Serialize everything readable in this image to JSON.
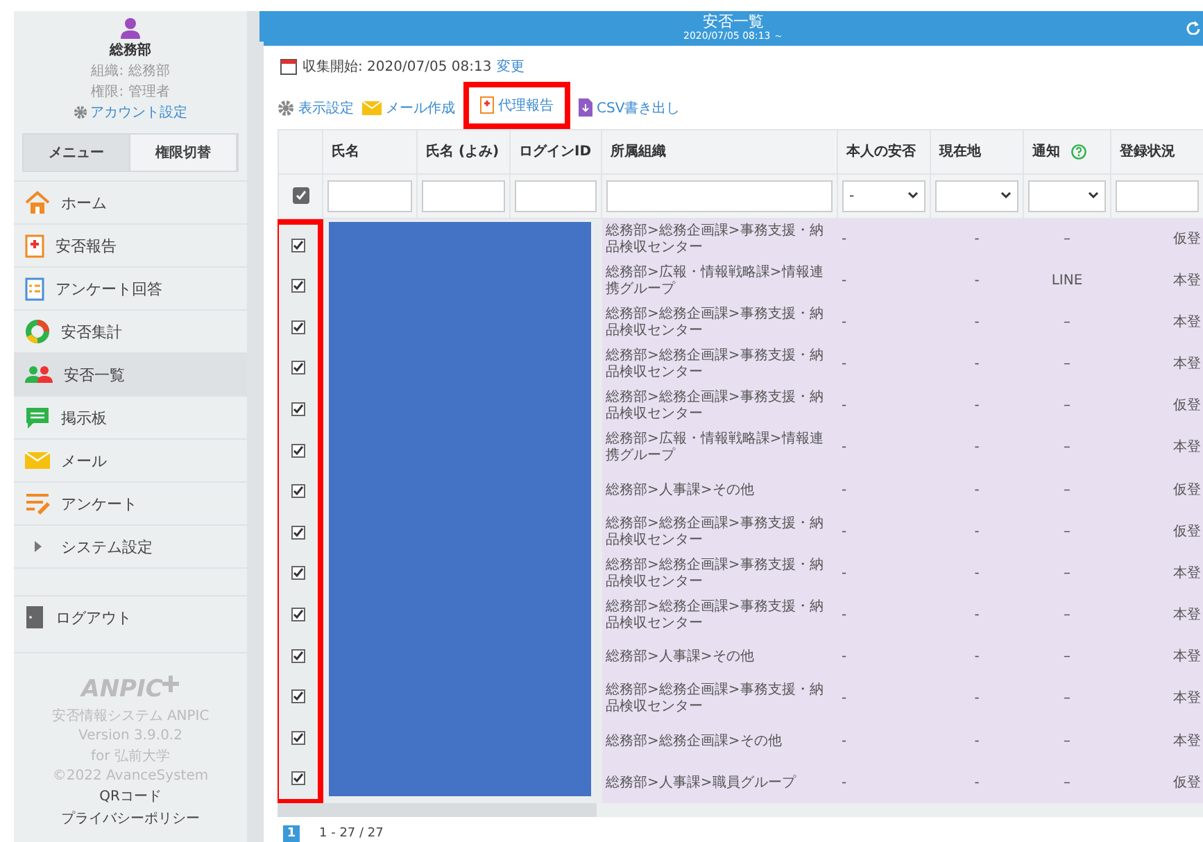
{
  "sidebar": {
    "user": {
      "name": "総務部",
      "org": "組織: 総務部",
      "role": "権限: 管理者",
      "account_link": "アカウント設定"
    },
    "tabs": [
      {
        "label": "メニュー",
        "selected": true
      },
      {
        "label": "権限切替",
        "selected": false
      }
    ],
    "items": [
      {
        "label": "ホーム",
        "kind": "link",
        "selected": false
      },
      {
        "label": "安否報告",
        "kind": "link",
        "selected": false
      },
      {
        "label": "アンケート回答",
        "kind": "link",
        "selected": false
      },
      {
        "label": "安否集計",
        "kind": "link",
        "selected": false
      },
      {
        "label": "安否一覧",
        "kind": "link",
        "selected": true
      },
      {
        "label": "掲示板",
        "kind": "link",
        "selected": false
      },
      {
        "label": "メール",
        "kind": "link",
        "selected": false
      },
      {
        "label": "アンケート",
        "kind": "link",
        "selected": false
      },
      {
        "label": "システム設定",
        "kind": "group",
        "selected": false
      }
    ],
    "logout": "ログアウト",
    "footer": {
      "logo": "ANPIC",
      "product": "安否情報システム ANPIC",
      "version": "Version 3.9.0.2",
      "for": "for 弘前大学",
      "copyright": "©2022 AvanceSystem",
      "links": [
        "QRコード",
        "プライバシーポリシー"
      ]
    }
  },
  "header": {
    "title": "安否一覧",
    "subtitle": "2020/07/05 08:13 ～"
  },
  "collection": {
    "label": "収集開始: 2020/07/05 08:13",
    "link": "変更"
  },
  "toolbar": [
    {
      "label": "表示設定",
      "highlighted": false
    },
    {
      "label": "メール作成",
      "highlighted": false
    },
    {
      "label": "代理報告",
      "highlighted": true
    },
    {
      "label": "CSV書き出し",
      "highlighted": false
    }
  ],
  "table": {
    "columns": [
      "氏名",
      "氏名 (よみ)",
      "ログインID",
      "所属組織",
      "本人の安否",
      "現在地",
      "通知",
      "登録状況"
    ],
    "header_checked": true,
    "filters": [
      {
        "kind": "input"
      },
      {
        "kind": "input"
      },
      {
        "kind": "input"
      },
      {
        "kind": "input"
      },
      {
        "kind": "select",
        "value": "-"
      },
      {
        "kind": "select"
      },
      {
        "kind": "select"
      },
      {
        "kind": "input"
      }
    ],
    "names_redacted": true,
    "checkbox_column_highlighted": true,
    "rows": [
      {
        "checked": true,
        "org": "総務部>総務企画課>事務支援・納品検収センター",
        "safety": "-",
        "location": "-",
        "notify": "–",
        "status": "仮登"
      },
      {
        "checked": true,
        "org": "総務部>広報・情報戦略課>情報連携グループ",
        "safety": "-",
        "location": "-",
        "notify": "LINE",
        "status": "本登"
      },
      {
        "checked": true,
        "org": "総務部>総務企画課>事務支援・納品検収センター",
        "safety": "-",
        "location": "-",
        "notify": "–",
        "status": "本登"
      },
      {
        "checked": true,
        "org": "総務部>総務企画課>事務支援・納品検収センター",
        "safety": "-",
        "location": "-",
        "notify": "–",
        "status": "本登"
      },
      {
        "checked": true,
        "org": "総務部>総務企画課>事務支援・納品検収センター",
        "safety": "-",
        "location": "-",
        "notify": "–",
        "status": "仮登"
      },
      {
        "checked": true,
        "org": "総務部>広報・情報戦略課>情報連携グループ",
        "safety": "-",
        "location": "-",
        "notify": "–",
        "status": "本登"
      },
      {
        "checked": true,
        "org": "総務部>人事課>その他",
        "safety": "-",
        "location": "-",
        "notify": "–",
        "status": "仮登"
      },
      {
        "checked": true,
        "org": "総務部>総務企画課>事務支援・納品検収センター",
        "safety": "-",
        "location": "-",
        "notify": "–",
        "status": "仮登"
      },
      {
        "checked": true,
        "org": "総務部>総務企画課>事務支援・納品検収センター",
        "safety": "-",
        "location": "-",
        "notify": "–",
        "status": "本登"
      },
      {
        "checked": true,
        "org": "総務部>総務企画課>事務支援・納品検収センター",
        "safety": "-",
        "location": "-",
        "notify": "–",
        "status": "本登"
      },
      {
        "checked": true,
        "org": "総務部>人事課>その他",
        "safety": "-",
        "location": "-",
        "notify": "–",
        "status": "本登"
      },
      {
        "checked": true,
        "org": "総務部>総務企画課>事務支援・納品検収センター",
        "safety": "-",
        "location": "-",
        "notify": "–",
        "status": "本登"
      },
      {
        "checked": true,
        "org": "総務部>総務企画課>その他",
        "safety": "-",
        "location": "-",
        "notify": "–",
        "status": "本登"
      },
      {
        "checked": true,
        "org": "総務部>人事課>職員グループ",
        "safety": "-",
        "location": "-",
        "notify": "–",
        "status": "仮登"
      }
    ]
  },
  "pagination": {
    "pages": [
      {
        "label": "1",
        "selected": true
      }
    ],
    "summary": "1 - 27 / 27"
  }
}
